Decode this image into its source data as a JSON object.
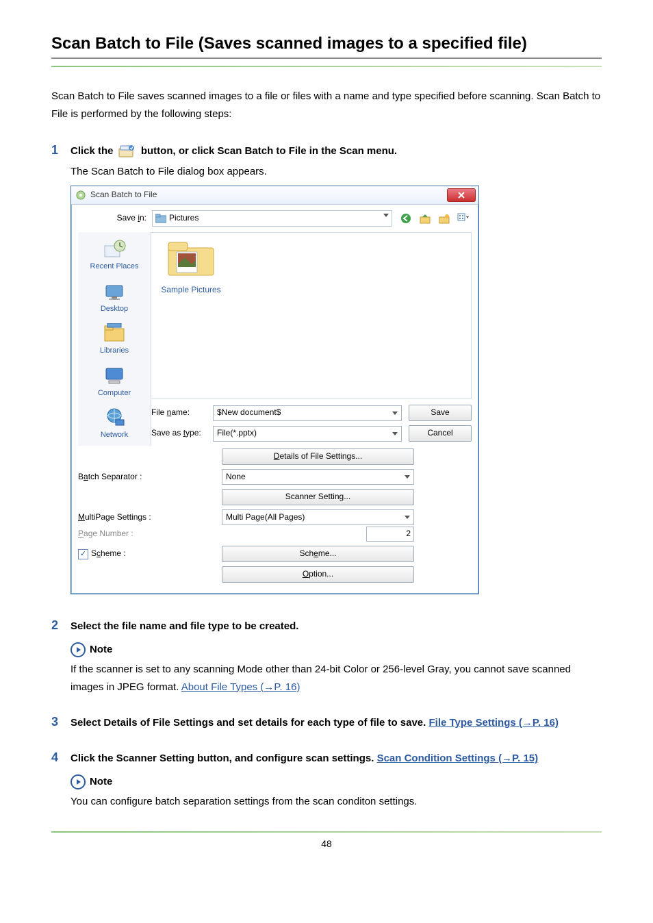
{
  "page": {
    "title": "Scan Batch to File (Saves scanned images to a specified file)",
    "intro": "Scan Batch to File saves scanned images to a file or files with a name and type specified before scanning. Scan Batch to File is performed by the following steps:",
    "page_number": "48"
  },
  "steps": {
    "s1": {
      "num": "1",
      "part_a": "Click the ",
      "part_b": " button, or click Scan Batch to File in the Scan menu.",
      "after": "The Scan Batch to File dialog box appears."
    },
    "s2": {
      "num": "2",
      "text": "Select the file name and file type to be created."
    },
    "s3": {
      "num": "3",
      "text_a": "Select Details of File Settings and set details for each type of file to save. ",
      "link": "File Type Settings (→P. 16)"
    },
    "s4": {
      "num": "4",
      "text_a": "Click the Scanner Setting button, and configure scan settings. ",
      "link": "Scan Condition Settings (→P. 15)"
    }
  },
  "notes": {
    "label": "Note",
    "n1_text_a": "If the scanner is set to any scanning Mode other than 24-bit Color or 256-level Gray, you cannot save scanned images in JPEG format. ",
    "n1_link": "About File Types (→P. 16)",
    "n2_text": "You can configure batch separation settings from the scan conditon settings."
  },
  "dialog": {
    "title": "Scan Batch to File",
    "save_in_label": "Save in:",
    "save_in_value": "Pictures",
    "places": {
      "recent": "Recent Places",
      "desktop": "Desktop",
      "libraries": "Libraries",
      "computer": "Computer",
      "network": "Network"
    },
    "folder_item": "Sample Pictures",
    "file_name_label": "File name:",
    "file_name_value": "$New document$",
    "save_as_type_label": "Save as type:",
    "save_as_type_value": "File(*.pptx)",
    "details_btn": "Details of File Settings...",
    "batch_sep_label": "Batch Separator :",
    "batch_sep_value": "None",
    "scanner_setting_btn": "Scanner Setting...",
    "multipage_label": "MultiPage Settings :",
    "multipage_value": "Multi Page(All Pages)",
    "page_number_label": "Page Number :",
    "page_number_value": "2",
    "scheme_check_label": "Scheme :",
    "scheme_btn": "Scheme...",
    "option_btn": "Option...",
    "save_btn": "Save",
    "cancel_btn": "Cancel"
  }
}
